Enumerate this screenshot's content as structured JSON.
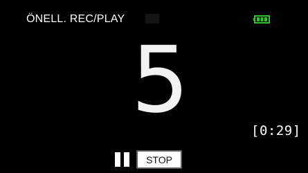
{
  "header": {
    "mode_title": "ÖNELL. REC/PLAY"
  },
  "status": {
    "battery_icon": "battery-full-icon",
    "battery_color": "#2ec42e"
  },
  "main": {
    "countdown_value": "5",
    "time_remaining": "[0:29]"
  },
  "controls": {
    "pause_icon": "pause-icon",
    "stop_label": "STOP"
  }
}
